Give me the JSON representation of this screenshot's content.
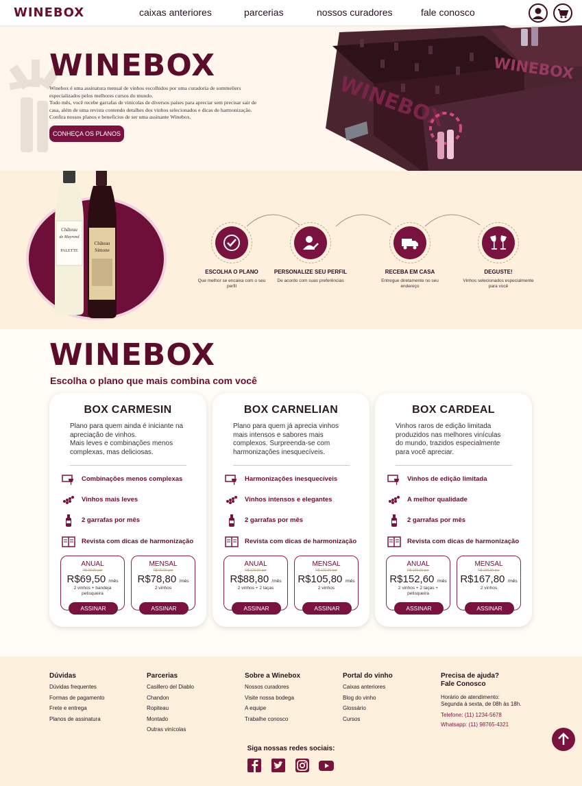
{
  "nav": {
    "logo": "WINEBOX",
    "links": [
      "caixas anteriores",
      "parcerias",
      "nossos curadores",
      "fale conosco"
    ],
    "user_icon": "user-icon",
    "cart_icon": "cart-icon"
  },
  "hero": {
    "logo": "WINEBOX",
    "description": [
      "Winebox é uma assinatura mensal de vinhos escolhidos por uma curadoria de sommeliers",
      "especializados pelos melhores cursos do mundo.",
      "Todo mês, você recebe garrafas de vinícolas de diversos países para apreciar sem precisar sair de",
      "casa, além de uma revista contendo detalhes dos vinhos selecionados e dicas de harmonização.",
      "Confira nossos planos e benefícios de ser uma assinante Winebox."
    ],
    "cta": "CONHEÇA OS PLANOS",
    "box_label": "WINEBOX"
  },
  "bottles": {
    "white_label_1": "Château",
    "white_label_2": "de Mayrond",
    "white_label_3": "PALETTE",
    "red_label_1": "Château",
    "red_label_2": "Simone"
  },
  "steps": [
    {
      "title": "ESCOLHA O PLANO",
      "desc": "Que melhor se encaixa com o seu perfil",
      "icon": "check-icon"
    },
    {
      "title": "PERSONALIZE SEU PERFIL",
      "desc": "De acordo com suas preferências",
      "icon": "profile-edit-icon"
    },
    {
      "title": "RECEBA EM CASA",
      "desc": "Entregue diretamente no seu endereço",
      "icon": "delivery-truck-icon"
    },
    {
      "title": "DEGUSTE!",
      "desc": "Vinhos selecionados especialmente para você",
      "icon": "wine-glasses-icon"
    }
  ],
  "plans": {
    "logo": "WINEBOX",
    "subtitle": "Escolha o plano que mais combina com você",
    "cards": [
      {
        "title": "BOX CARMESIN",
        "desc": [
          "Plano para quem ainda é iniciante na",
          "apreciação de vinhos.",
          "Mais leves e combinações menos",
          "complexas, mas deliciosas."
        ],
        "features": [
          "Combinações menos complexas",
          "Vinhos mais leves",
          "2 garrafas por mês",
          "Revista com dicas de harmonização"
        ],
        "prices": [
          {
            "period": "ANUAL",
            "old": "R$ 90,00 por",
            "value": "R$69,50",
            "unit": "/mês",
            "note": [
              "2 vinhos + bandeja",
              "petisqueira"
            ],
            "button": "ASSINAR"
          },
          {
            "period": "MENSAL",
            "old": "R$ 90,00 por",
            "value": "R$78,80",
            "unit": "/mês",
            "note": [
              "2 vinhos"
            ],
            "button": "ASSINAR"
          }
        ]
      },
      {
        "title": "BOX CARNELIAN",
        "desc": [
          "Plano para quem já aprecia vinhos",
          "mais intensos e sabores mais",
          "complexos. Surpreenda-se com",
          "harmonizações inesquecíveis."
        ],
        "features": [
          "Harmonizações inesquecíveis",
          "Vinhos intensos e elegantes",
          "2 garrafas por mês",
          "Revista com dicas de harmonização"
        ],
        "prices": [
          {
            "period": "ANUAL",
            "old": "R$ 120,00 por",
            "value": "R$88,80",
            "unit": "/mês",
            "note": [
              "2 vinhos + 2 taças"
            ],
            "button": "ASSINAR"
          },
          {
            "period": "MENSAL",
            "old": "R$ 120,00 por",
            "value": "R$105,80",
            "unit": "/mês",
            "note": [
              "2 vinhos"
            ],
            "button": "ASSINAR"
          }
        ]
      },
      {
        "title": "BOX CARDEAL",
        "desc": [
          "Vinhos raros de edição limitada",
          "produzidos nas melhores vinículas",
          "do mundo, trazidos especialmente",
          "para você apreciar."
        ],
        "features": [
          "Vinhos de edição limitada",
          "A melhor qualidade",
          "2 garrafas por mês",
          "Revista com dicas de harmonização"
        ],
        "prices": [
          {
            "period": "ANUAL",
            "old": "R$ 190,00 por",
            "value": "R$152,60",
            "unit": "/mês",
            "note": [
              "2 vinhos + 2 taças +",
              "petisqueira"
            ],
            "button": "ASSINAR"
          },
          {
            "period": "MENSAL",
            "old": "R$ 190,00 por",
            "value": "R$167,80",
            "unit": "/mês",
            "note": [
              "2 vinhos"
            ],
            "button": "ASSINAR"
          }
        ]
      }
    ]
  },
  "footer": {
    "columns": [
      {
        "title": "Dúvidas",
        "items": [
          "Dúvidas frequentes",
          "Formas de pagamento",
          "Frete e entrega",
          "Planos de assinatura"
        ]
      },
      {
        "title": "Parcerias",
        "items": [
          "Casillero del Diablo",
          "Chandon",
          "Ropiteau",
          "Montado",
          "Outras vinícolas"
        ]
      },
      {
        "title": "Sobre a Winebox",
        "items": [
          "Nossos curadores",
          "Visite nossa bodega",
          "A equipe",
          "Trabalhe conosco"
        ]
      },
      {
        "title": "Portal do vinho",
        "items": [
          "Caixas anteriores",
          "Blog do vinho",
          "Glossário",
          "Cursos"
        ]
      }
    ],
    "help": {
      "title1": "Precisa de ajuda?",
      "title2": "Fale Conosco",
      "hours1": "Horário de atendimento:",
      "hours2": "Segunda à sexta, de 08h às 18h.",
      "phone": "Telefone: (11) 1234-5678",
      "whatsapp": "Whatsapp: (11) 98765-4321"
    },
    "social_title": "Siga nossas redes sociais:",
    "social": [
      "facebook-icon",
      "twitter-icon",
      "instagram-icon",
      "youtube-icon"
    ]
  },
  "colors": {
    "brand": "#7a1240",
    "brand_dark": "#5b0c2b",
    "cream": "#fdf0dc"
  }
}
